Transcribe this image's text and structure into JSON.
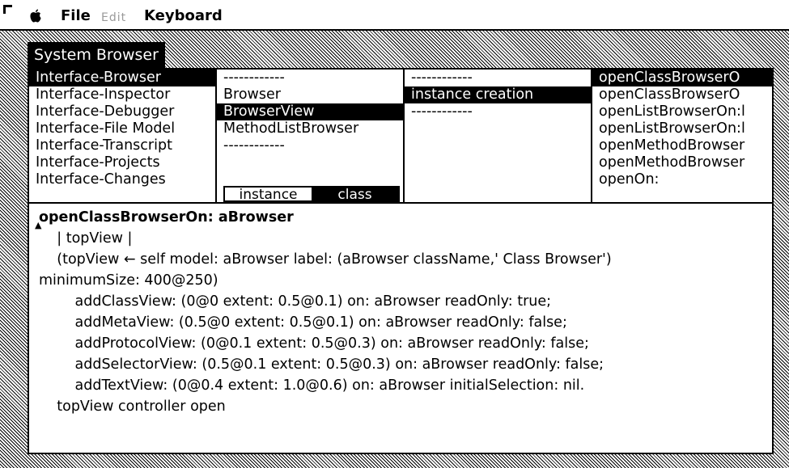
{
  "menubar": {
    "apple_icon": "apple-icon",
    "file": "File",
    "edit": "Edit",
    "keyboard": "Keyboard"
  },
  "window": {
    "title": "System Browser"
  },
  "categories": [
    {
      "label": "Interface-Browser",
      "selected": true
    },
    {
      "label": "Interface-Inspector",
      "selected": false
    },
    {
      "label": "Interface-Debugger",
      "selected": false
    },
    {
      "label": "Interface-File Model",
      "selected": false
    },
    {
      "label": "Interface-Transcript",
      "selected": false
    },
    {
      "label": "Interface-Projects",
      "selected": false
    },
    {
      "label": "Interface-Changes",
      "selected": false
    }
  ],
  "classes": [
    {
      "label": "------------",
      "selected": false
    },
    {
      "label": "Browser",
      "selected": false
    },
    {
      "label": "BrowserView",
      "selected": true
    },
    {
      "label": "MethodListBrowser",
      "selected": false
    },
    {
      "label": "------------",
      "selected": false
    }
  ],
  "class_toggle": {
    "instance": "instance",
    "class": "class",
    "active": "class"
  },
  "protocols": [
    {
      "label": "------------",
      "selected": false
    },
    {
      "label": "instance creation",
      "selected": true
    },
    {
      "label": "------------",
      "selected": false
    }
  ],
  "selectors": [
    {
      "label": "openClassBrowserO",
      "selected": true
    },
    {
      "label": "openClassBrowserO",
      "selected": false
    },
    {
      "label": "openListBrowserOn:l",
      "selected": false
    },
    {
      "label": "openListBrowserOn:l",
      "selected": false
    },
    {
      "label": "openMethodBrowser",
      "selected": false
    },
    {
      "label": "openMethodBrowser",
      "selected": false
    },
    {
      "label": "openOn:",
      "selected": false
    }
  ],
  "code": [
    {
      "text": "openClassBrowserOn: aBrowser",
      "bold": true
    },
    {
      "text": "    | topView |",
      "bold": false
    },
    {
      "text": "    (topView ← self model: aBrowser label: (aBrowser className,' Class Browser')",
      "bold": false
    },
    {
      "text": "minimumSize: 400@250)",
      "bold": false
    },
    {
      "text": "        addClassView: (0@0 extent: 0.5@0.1) on: aBrowser readOnly: true;",
      "bold": false
    },
    {
      "text": "        addMetaView: (0.5@0 extent: 0.5@0.1) on: aBrowser readOnly: false;",
      "bold": false
    },
    {
      "text": "        addProtocolView: (0@0.1 extent: 0.5@0.3) on: aBrowser readOnly: false;",
      "bold": false
    },
    {
      "text": "        addSelectorView: (0.5@0.1 extent: 0.5@0.3) on: aBrowser readOnly: false;",
      "bold": false
    },
    {
      "text": "        addTextView: (0@0.4 extent: 1.0@0.6) on: aBrowser initialSelection: nil.",
      "bold": false
    },
    {
      "text": "    topView controller open",
      "bold": false
    }
  ]
}
